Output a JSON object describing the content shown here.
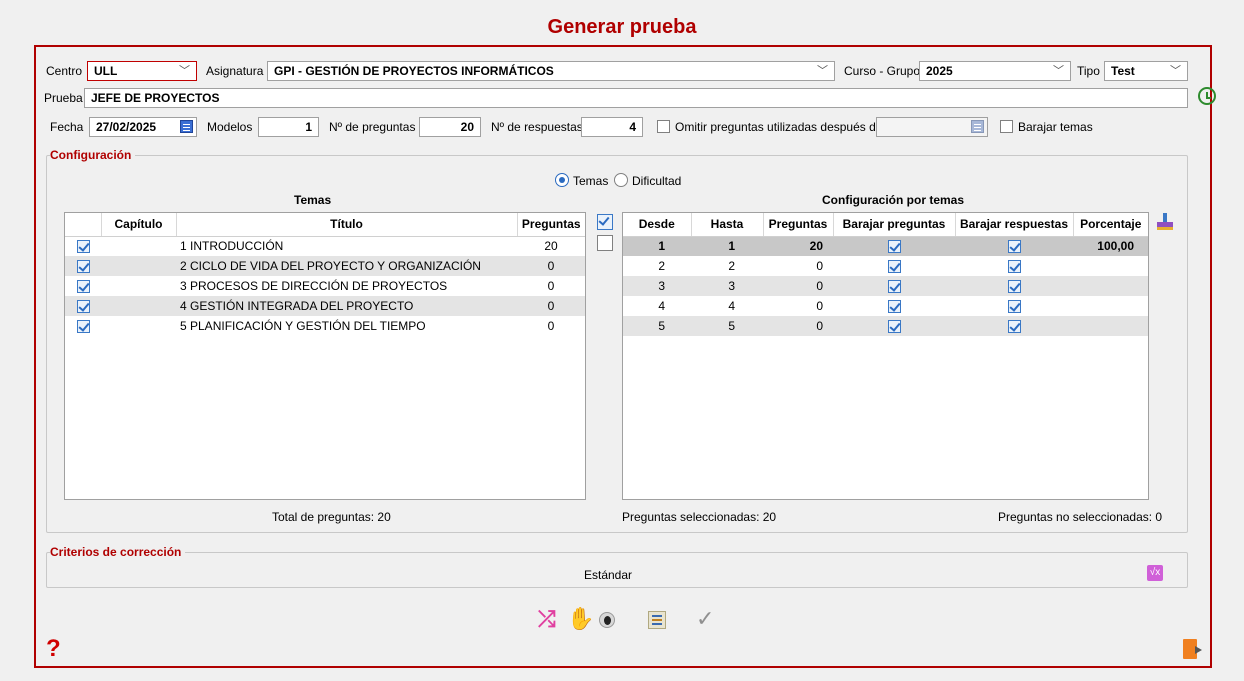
{
  "window": {
    "title": "Generar prueba"
  },
  "header": {
    "centro_label": "Centro",
    "centro_value": "ULL",
    "asignatura_label": "Asignatura",
    "asignatura_value": "GPI - GESTIÓN DE PROYECTOS INFORMÁTICOS",
    "curso_label": "Curso - Grupo",
    "curso_value": "2025",
    "tipo_label": "Tipo",
    "tipo_value": "Test",
    "prueba_label": "Prueba",
    "prueba_value": "JEFE DE PROYECTOS",
    "fecha_label": "Fecha",
    "fecha_value": "27/02/2025",
    "modelos_label": "Modelos",
    "modelos_value": "1",
    "npreguntas_label": "Nº de preguntas",
    "npreguntas_value": "20",
    "nrespuestas_label": "Nº de respuestas",
    "nrespuestas_value": "4",
    "omitir_label": "Omitir preguntas utilizadas después de",
    "omitir_checked": false,
    "barajar_temas_label": "Barajar temas",
    "barajar_temas_checked": false
  },
  "config": {
    "group_title": "Configuración",
    "radio_temas": "Temas",
    "radio_dificultad": "Dificultad",
    "selected_mode": "Temas",
    "temas_title": "Temas",
    "temas_columns": [
      "Capítulo",
      "Título",
      "Preguntas"
    ],
    "temas_rows": [
      {
        "checked": true,
        "titulo": "1 INTRODUCCIÓN",
        "preguntas": "20"
      },
      {
        "checked": true,
        "titulo": "2 CICLO DE VIDA DEL PROYECTO Y ORGANIZACIÓN",
        "preguntas": "0"
      },
      {
        "checked": true,
        "titulo": "3 PROCESOS DE DIRECCIÓN DE PROYECTOS",
        "preguntas": "0"
      },
      {
        "checked": true,
        "titulo": "4 GESTIÓN INTEGRADA DEL PROYECTO",
        "preguntas": "0"
      },
      {
        "checked": true,
        "titulo": "5 PLANIFICACIÓN Y GESTIÓN DEL TIEMPO",
        "preguntas": "0"
      }
    ],
    "total_label": "Total de preguntas: 20",
    "conf_title": "Configuración por temas",
    "conf_columns": [
      "Desde",
      "Hasta",
      "Preguntas",
      "Barajar preguntas",
      "Barajar respuestas",
      "Porcentaje"
    ],
    "conf_rows": [
      {
        "desde": "1",
        "hasta": "1",
        "preguntas": "20",
        "porcentaje": "100,00"
      },
      {
        "desde": "2",
        "hasta": "2",
        "preguntas": "0",
        "porcentaje": ""
      },
      {
        "desde": "3",
        "hasta": "3",
        "preguntas": "0",
        "porcentaje": ""
      },
      {
        "desde": "4",
        "hasta": "4",
        "preguntas": "0",
        "porcentaje": ""
      },
      {
        "desde": "5",
        "hasta": "5",
        "preguntas": "0",
        "porcentaje": ""
      }
    ],
    "seleccionadas_label": "Preguntas seleccionadas: 20",
    "no_seleccionadas_label": "Preguntas no seleccionadas: 0"
  },
  "criterios": {
    "group_title": "Criterios de corrección",
    "value": "Estándar"
  },
  "toolbar": {
    "icons": [
      "shuffle-icon",
      "hand-icon",
      "eye-icon",
      "document-list-icon",
      "checkmark-icon"
    ]
  },
  "footer": {
    "help_icon": "?",
    "exit_icon": "exit-door-icon"
  },
  "colors": {
    "accent": "#b00000",
    "check": "#2a6ac0",
    "background": "#f0f0f0"
  }
}
